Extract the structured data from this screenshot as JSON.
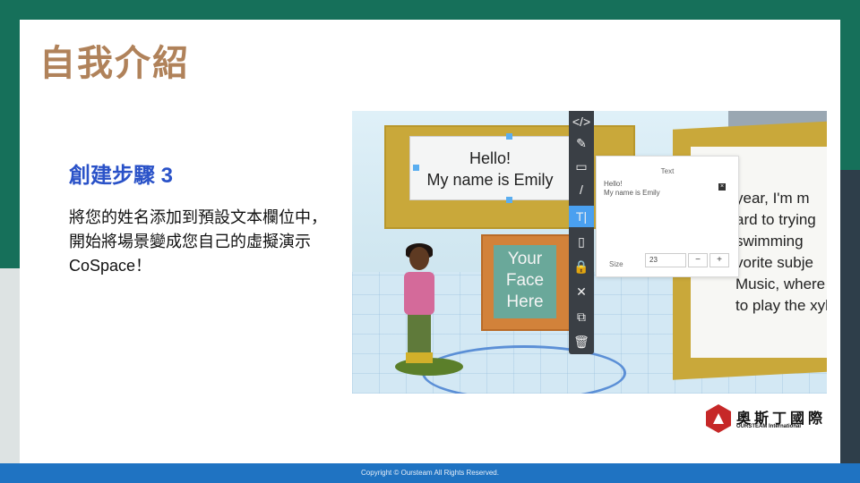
{
  "slide": {
    "title": "自我介紹",
    "subtitle": "創建步驟 3",
    "body_lines": [
      "將您的姓名添加到預設文本欄位中，",
      "開始將場景變成您自己的虛擬演示",
      "CoSpace！"
    ]
  },
  "screenshot": {
    "card_a_lines": [
      "Hello!",
      "My name is Emily"
    ],
    "card_b_lines": [
      "Your",
      "Face",
      "Here"
    ],
    "card_c_lines": [
      "year, I'm m",
      "ard to trying",
      "swimming",
      "vorite subje",
      "Music, where I",
      "to play the xyl"
    ],
    "toolbar": {
      "items": [
        {
          "name": "code-icon",
          "glyph": "</>"
        },
        {
          "name": "paint-icon",
          "glyph": "✎"
        },
        {
          "name": "speech-bubble-icon",
          "glyph": "▭"
        },
        {
          "name": "brush-icon",
          "glyph": "/"
        },
        {
          "name": "text-icon",
          "glyph": "T|"
        },
        {
          "name": "animation-icon",
          "glyph": "▯"
        },
        {
          "name": "lock-icon",
          "glyph": "🔒"
        },
        {
          "name": "hide-icon",
          "glyph": "✕"
        },
        {
          "name": "duplicate-icon",
          "glyph": "⧉"
        },
        {
          "name": "trash-icon",
          "glyph": "🗑"
        }
      ]
    },
    "text_panel": {
      "title": "Text",
      "text_value_line1": "Hello!",
      "text_value_line2": "My name is Emily",
      "close_glyph": "×",
      "size_label": "Size",
      "size_value": "23",
      "minus": "−",
      "plus": "+"
    }
  },
  "logo": {
    "name_cn": "奧斯丁國際",
    "name_en": "OURSTEAM International"
  },
  "footer": {
    "copyright": "Copyright © Oursteam All Rights Reserved."
  }
}
